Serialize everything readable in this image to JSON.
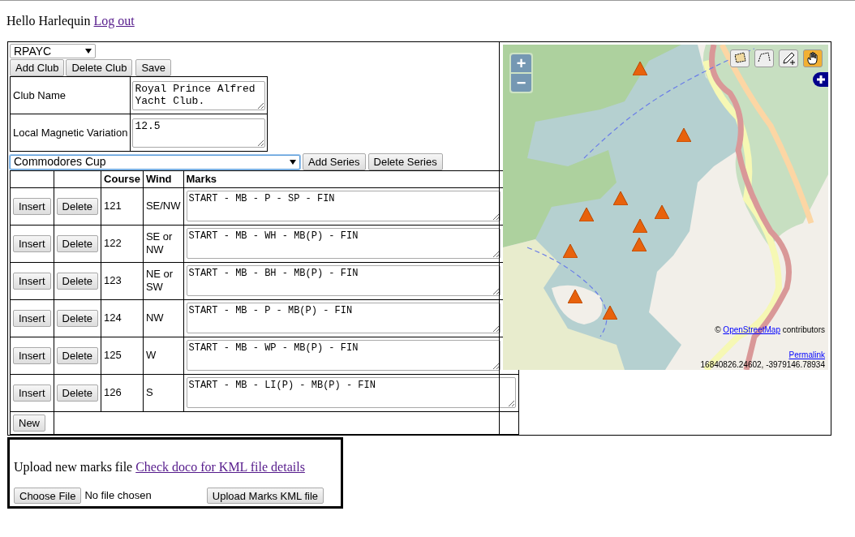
{
  "greeting": "Hello Harlequin",
  "logout_link": "Log out",
  "club_select": {
    "value": "RPAYC"
  },
  "club_buttons": [
    "Add Club",
    "Delete Club",
    "Save"
  ],
  "club_fields": [
    {
      "label": "Club Name",
      "value": "Royal Prince Alfred Yacht Club."
    },
    {
      "label": "Local Magnetic Variation",
      "value": "12.5"
    }
  ],
  "series_select": {
    "value": "Commodores Cup",
    "focused": true
  },
  "series_buttons": [
    "Add Series",
    "Delete Series"
  ],
  "courses": {
    "columns": [
      "Course",
      "Wind",
      "Marks"
    ],
    "rows": [
      {
        "insert": "Insert",
        "delete": "Delete",
        "course": "121",
        "wind": "SE/NW",
        "marks": "START - MB - P - SP - FIN"
      },
      {
        "insert": "Insert",
        "delete": "Delete",
        "course": "122",
        "wind": "SE or NW",
        "marks": "START - MB - WH - MB(P) - FIN"
      },
      {
        "insert": "Insert",
        "delete": "Delete",
        "course": "123",
        "wind": "NE or SW",
        "marks": "START - MB - BH - MB(P) - FIN"
      },
      {
        "insert": "Insert",
        "delete": "Delete",
        "course": "124",
        "wind": "NW",
        "marks": "START - MB - P - MB(P) - FIN"
      },
      {
        "insert": "Insert",
        "delete": "Delete",
        "course": "125",
        "wind": "W",
        "marks": "START - MB - WP - MB(P) - FIN"
      },
      {
        "insert": "Insert",
        "delete": "Delete",
        "course": "126",
        "wind": "S",
        "marks": "START - MB - LI(P) - MB(P) - FIN"
      }
    ],
    "new_button": "New"
  },
  "map": {
    "kind": "picture",
    "zoom_in": "+",
    "zoom_out": "−",
    "tools": [
      {
        "kind": "polygon",
        "selected": false
      },
      {
        "kind": "path",
        "selected": false
      },
      {
        "kind": "draw",
        "selected": false
      },
      {
        "kind": "pan",
        "selected": true
      }
    ],
    "attribution_prefix": "©",
    "attribution_link": "OpenStreetMap",
    "attribution_suffix": "contributors",
    "permalink": "Permalink",
    "coordinates": "16840826.24602, -3979146.78934"
  },
  "upload": {
    "text": "Upload new marks file",
    "link": "Check doco for KML file details",
    "choose_button": "Choose File",
    "file_status": "No file chosen",
    "upload_button": "Upload Marks KML file"
  }
}
